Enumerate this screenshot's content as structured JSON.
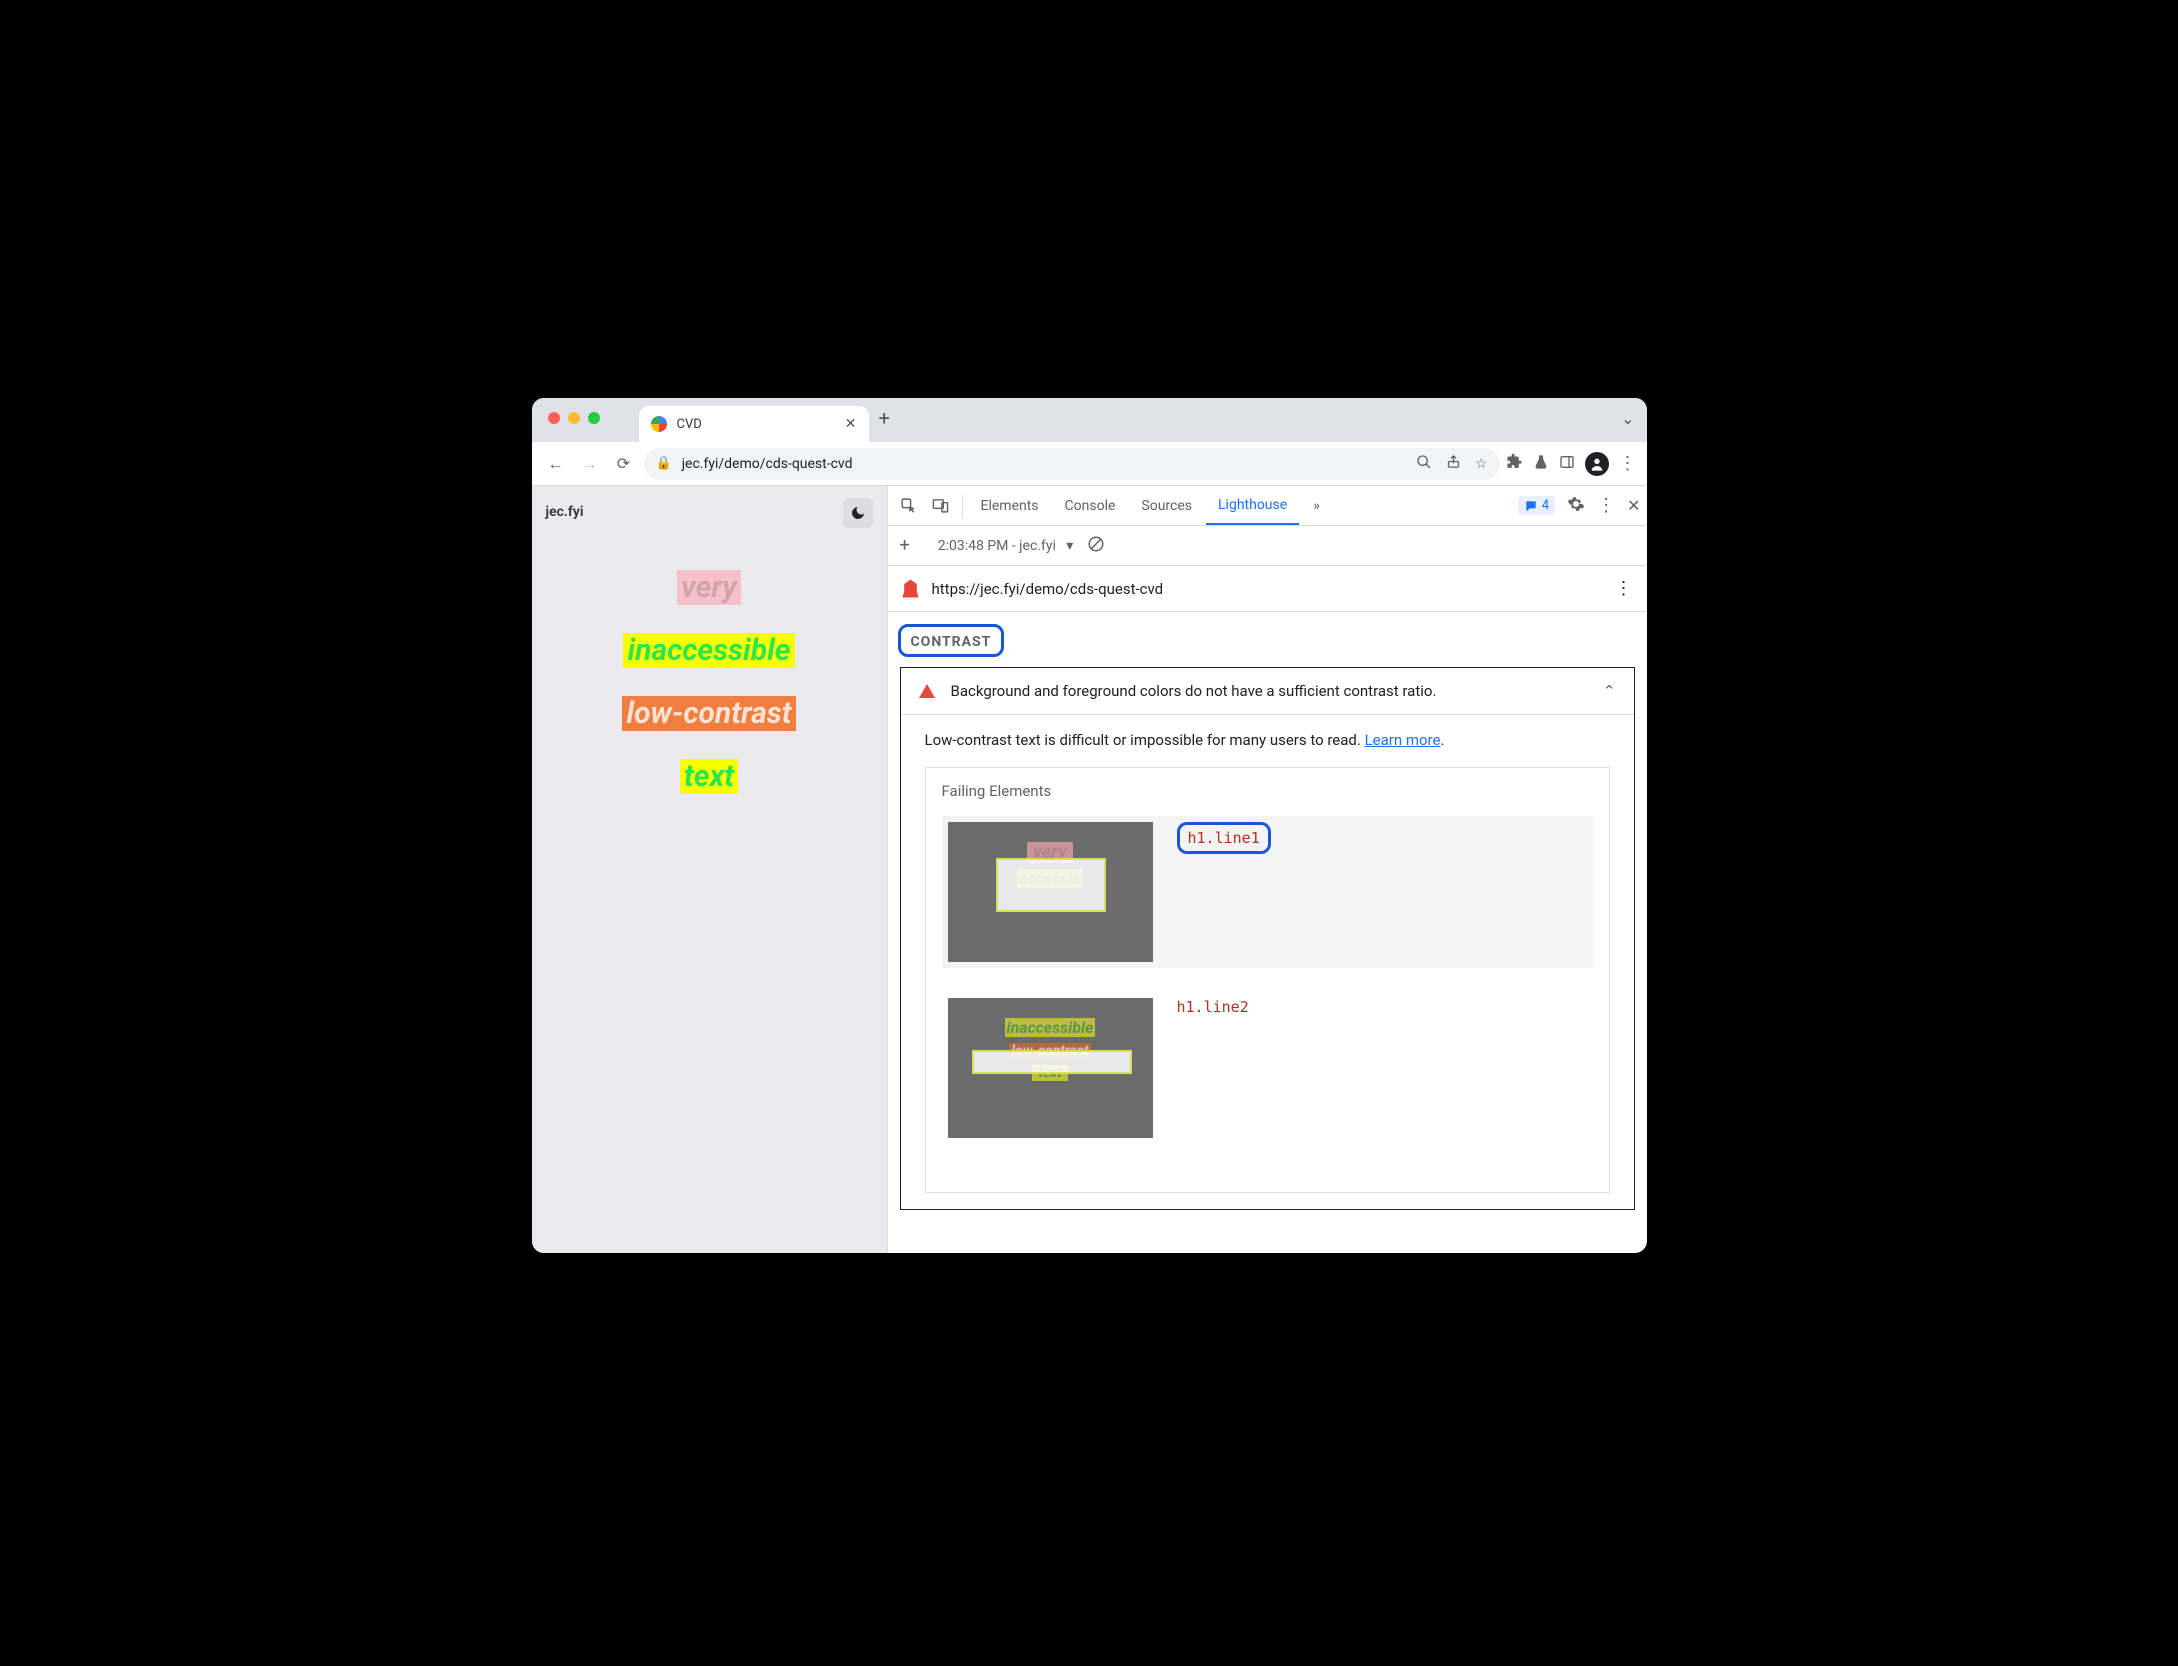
{
  "browser": {
    "tab_title": "CVD",
    "url_display": "jec.fyi/demo/cds-quest-cvd"
  },
  "page": {
    "site_name": "jec.fyi",
    "lines": [
      "very",
      "inaccessible",
      "low-contrast",
      "text"
    ]
  },
  "devtools": {
    "tabs": [
      "Elements",
      "Console",
      "Sources",
      "Lighthouse"
    ],
    "active_tab": "Lighthouse",
    "overflow": "»",
    "message_count": "4",
    "subbar": {
      "report_label": "2:03:48 PM - jec.fyi"
    },
    "report_url": "https://jec.fyi/demo/cds-quest-cvd",
    "section_label": "CONTRAST",
    "audit": {
      "title": "Background and foreground colors do not have a sufficient contrast ratio.",
      "description": "Low-contrast text is difficult or impossible for many users to read. ",
      "learn_more": "Learn more",
      "period": ".",
      "failing_heading": "Failing Elements",
      "items": [
        {
          "selector": "h1.line1"
        },
        {
          "selector": "h1.line2"
        }
      ]
    }
  }
}
